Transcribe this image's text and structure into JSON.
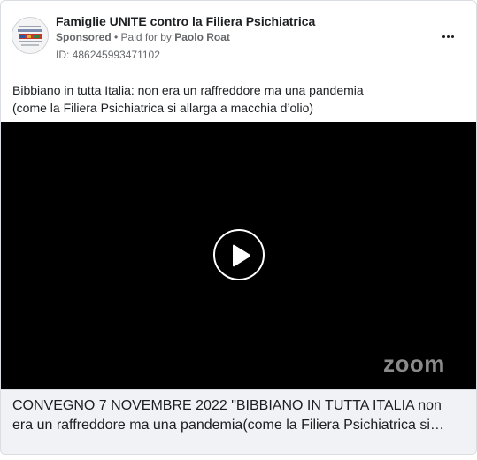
{
  "ad": {
    "page_name": "Famiglie UNITE contro la Filiera Psichiatrica",
    "sponsored_label": "Sponsored",
    "separator": " • ",
    "paid_for_label": "Paid for by ",
    "payer_name": "Paolo Roat",
    "ad_id": "ID: 486245993471102",
    "more_icon": "more-horizontal-icon"
  },
  "post": {
    "text_line1": "Bibbiano in tutta Italia: non era un raffreddore ma una pandemia",
    "text_line2": "(come la Filiera Psichiatrica si allarga a macchia d’olio)"
  },
  "video": {
    "play_icon": "play-icon",
    "watermark": "zoom"
  },
  "link": {
    "caption_line1": "CONVEGNO 7 NOVEMBRE 2022 \"BIBBIANO IN TUTTA ITALIA non",
    "caption_line2": "era un raffreddore ma una pandemia(come la Filiera Psichiatrica si…"
  }
}
